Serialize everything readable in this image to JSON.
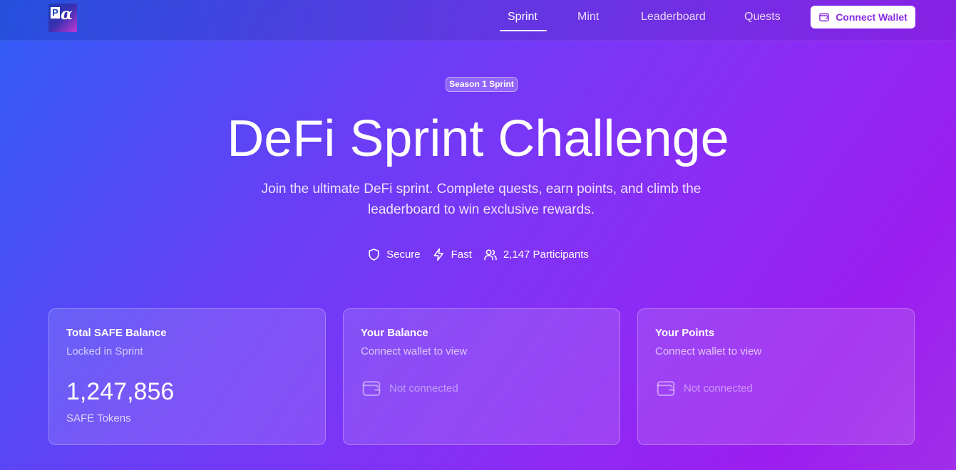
{
  "header": {
    "logo_letter": "P",
    "logo_glyph": "α",
    "nav": [
      {
        "label": "Sprint",
        "active": true
      },
      {
        "label": "Mint",
        "active": false
      },
      {
        "label": "Leaderboard",
        "active": false
      },
      {
        "label": "Quests",
        "active": false
      }
    ],
    "connect_label": "Connect Wallet",
    "connect_icon": "wallet-icon"
  },
  "hero": {
    "badge": "Season 1 Sprint",
    "title": "DeFi Sprint Challenge",
    "subtitle": "Join the ultimate DeFi sprint. Complete quests, earn points, and climb the leaderboard to win exclusive rewards.",
    "features": [
      {
        "icon": "shield-icon",
        "label": "Secure"
      },
      {
        "icon": "lightning-icon",
        "label": "Fast"
      },
      {
        "icon": "users-icon",
        "label": "2,147 Participants"
      }
    ]
  },
  "cards": [
    {
      "title": "Total SAFE Balance",
      "subtitle": "Locked in Sprint",
      "value": "1,247,856",
      "unit": "SAFE Tokens"
    },
    {
      "title": "Your Balance",
      "subtitle": "Connect wallet to view",
      "empty_label": "Not connected",
      "empty_icon": "wallet-icon"
    },
    {
      "title": "Your Points",
      "subtitle": "Connect wallet to view",
      "empty_label": "Not connected",
      "empty_icon": "wallet-icon"
    }
  ],
  "colors": {
    "gradient_start": "#2f5cf6",
    "gradient_mid": "#8b2cf5",
    "gradient_end": "#9c1ef0",
    "button_text": "#8a2be2",
    "button_bg": "#ffffff"
  }
}
